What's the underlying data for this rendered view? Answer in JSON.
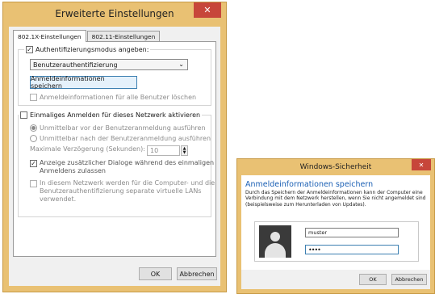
{
  "window1": {
    "title": "Erweiterte Einstellungen",
    "close_glyph": "✕",
    "tabs": [
      {
        "label": "802.1X-Einstellungen",
        "active": true
      },
      {
        "label": "802.11-Einstellungen",
        "active": false
      }
    ],
    "auth_mode": {
      "checkbox_label": "Authentifizierungsmodus angeben:",
      "checked": true,
      "selected_mode": "Benutzerauthentifizierung",
      "save_button": "Anmeldeinformationen speichern",
      "delete_all_label": "Anmeldeinformationen für alle Benutzer löschen"
    },
    "sso": {
      "checkbox_label": "Einmaliges Anmelden für dieses Netzwerk aktivieren",
      "checked": false,
      "radio_before": "Unmittelbar vor der Benutzeranmeldung ausführen",
      "radio_after": "Unmittelbar nach der Benutzeranmeldung ausführen",
      "max_delay_label": "Maximale Verzögerung (Sekunden):",
      "max_delay_value": "10",
      "additional_dialogs_line1": "Anzeige zusätzlicher Dialoge während des einmaligen",
      "additional_dialogs_line2": "Anmeldens zulassen",
      "vlan_line1": "In diesem Netzwerk werden für die Computer- und die",
      "vlan_line2": "Benutzerauthentifizierung separate virtuelle LANs",
      "vlan_line3": "verwendet."
    },
    "ok_button": "OK",
    "cancel_button": "Abbrechen"
  },
  "window2": {
    "title": "Windows-Sicherheit",
    "close_glyph": "✕",
    "heading": "Anmeldeinformationen speichern",
    "description": "Durch das Speichern der Anmeldeinformationen kann der Computer eine Verbindung mit dem Netzwerk herstellen, wenn Sie nicht angemeldet sind (beispielsweise zum Herunterladen von Updates).",
    "username_value": "muster",
    "password_value": "••••",
    "ok_button": "OK",
    "cancel_button": "Abbrechen"
  },
  "glyphs": {
    "check": "✓",
    "chevron_down": "⌄",
    "spin_up": "▲",
    "spin_down": "▼"
  },
  "colors": {
    "window_frame": "#e9c173",
    "close_button": "#c7463a",
    "heading_blue": "#1a5fb4"
  }
}
